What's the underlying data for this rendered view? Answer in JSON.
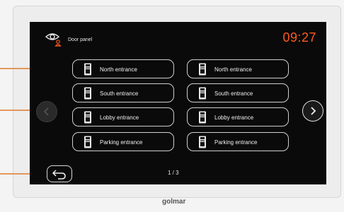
{
  "header": {
    "title": "Door panel",
    "time": "09:27",
    "accent_color": "#ff5a1f"
  },
  "entrances": {
    "left": [
      {
        "label": "North entrance"
      },
      {
        "label": "South entrance"
      },
      {
        "label": "Lobby entrance"
      },
      {
        "label": "Parking entrance"
      }
    ],
    "right": [
      {
        "label": "North entrance"
      },
      {
        "label": "South entrance"
      },
      {
        "label": "Lobby entrance"
      },
      {
        "label": "Parking entrance"
      }
    ]
  },
  "pagination": {
    "text": "1 / 3"
  },
  "brand": {
    "name": "golmar"
  },
  "icons": {
    "eye": "eye-icon",
    "panel": "door-panel-icon",
    "prev": "chevron-left-icon",
    "next": "chevron-right-icon",
    "back": "back-arrow-icon"
  }
}
